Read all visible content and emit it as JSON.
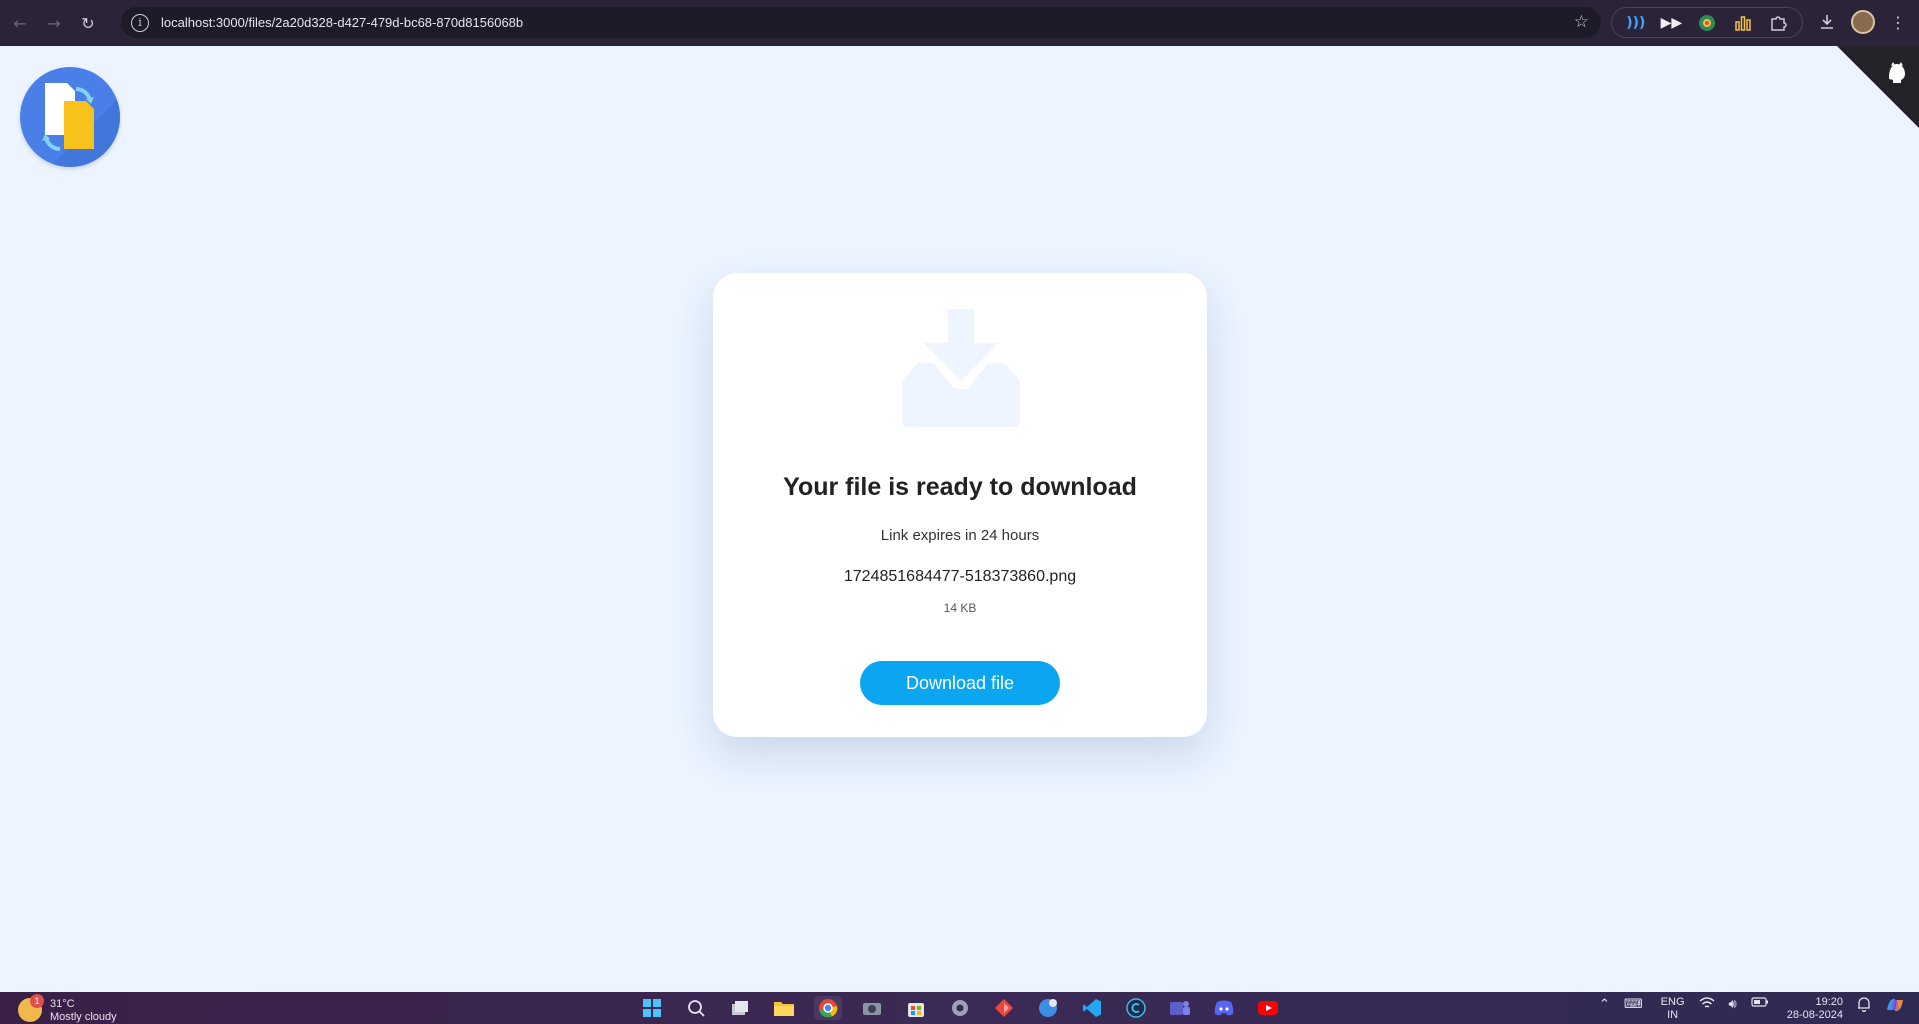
{
  "browser": {
    "url": "localhost:3000/files/2a20d328-d427-479d-bc68-870d8156068b",
    "back_icon": "arrow-left-icon",
    "forward_icon": "arrow-right-icon",
    "reload_icon": "reload-icon",
    "site_info_icon": "info-icon",
    "bookmark_icon": "star-icon",
    "extensions": [
      "wave-icon",
      "fast-forward-icon",
      "color-picker-icon",
      "chart-icon",
      "puzzle-icon"
    ],
    "download_icon": "download-icon",
    "menu_icon": "kebab-menu-icon"
  },
  "page": {
    "background_color": "#ebf4ff",
    "logo": "file-convert-logo",
    "corner_icon": "github-icon"
  },
  "card": {
    "illustration": "download-tray-icon",
    "title": "Your file is ready to download",
    "expiry": "Link expires in 24 hours",
    "filename": "1724851684477-518373860.png",
    "size": "14 KB",
    "button_label": "Download file",
    "accent_color": "#0ba5f0"
  },
  "taskbar": {
    "weather": {
      "badge": "1",
      "temperature": "31°C",
      "condition": "Mostly cloudy"
    },
    "apps": [
      "windows-start-icon",
      "search-icon",
      "task-view-icon",
      "file-explorer-icon",
      "chrome-icon",
      "camera-icon",
      "store-icon",
      "settings-icon",
      "app-icon",
      "app-icon",
      "vscode-icon",
      "app-icon",
      "teams-icon",
      "discord-icon",
      "youtube-icon"
    ],
    "tray": {
      "lang_top": "ENG",
      "lang_bottom": "IN",
      "time": "19:20",
      "date": "28-08-2024"
    }
  }
}
